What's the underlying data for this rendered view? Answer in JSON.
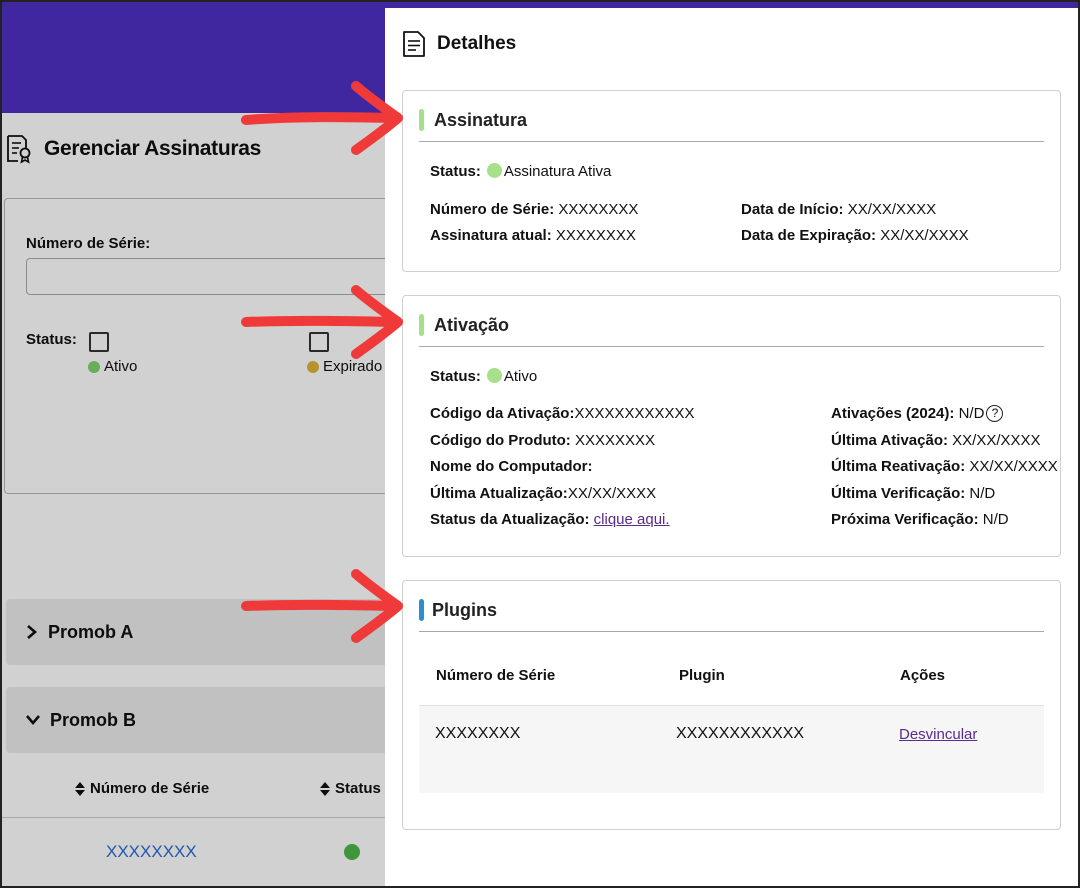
{
  "background": {
    "page_title": "Gerenciar Assinaturas",
    "filter": {
      "serial_label": "Número de Série:",
      "status_label": "Status:",
      "options": [
        {
          "label": "Ativo",
          "color": "#7fd46e"
        },
        {
          "label": "Expirado",
          "color": "#e0b43a"
        }
      ]
    },
    "accordions": [
      {
        "label": "Promob A",
        "expanded": false
      },
      {
        "label": "Promob B",
        "expanded": true
      }
    ],
    "table": {
      "columns": [
        "Número de Série",
        "Status"
      ],
      "rows": [
        {
          "serial": "XXXXXXXX",
          "status_color": "#4db847"
        }
      ]
    }
  },
  "drawer": {
    "title": "Detalhes",
    "assinatura": {
      "title": "Assinatura",
      "accent": "#a6e08a",
      "status_label": "Status:",
      "status_value": "Assinatura Ativa",
      "serial_label": "Número de Série:",
      "serial_value": "XXXXXXXX",
      "current_label": "Assinatura atual:",
      "current_value": "XXXXXXXX",
      "start_label": "Data de Início:",
      "start_value": "XX/XX/XXXX",
      "expiry_label": "Data de Expiração:",
      "expiry_value": "XX/XX/XXXX"
    },
    "ativacao": {
      "title": "Ativação",
      "accent": "#a6e08a",
      "status_label": "Status:",
      "status_value": "Ativo",
      "left": [
        {
          "label": "Código da Ativação:",
          "value": "XXXXXXXXXXXX"
        },
        {
          "label": "Código do Produto:",
          "value": "XXXXXXXX"
        },
        {
          "label": "Nome do Computador:",
          "value": ""
        },
        {
          "label": "Última Atualização:",
          "value": "XX/XX/XXXX"
        },
        {
          "label": "Status da Atualização:",
          "value": "clique aqui."
        }
      ],
      "right": [
        {
          "label": "Ativações (2024):",
          "value": "N/D",
          "help": "?"
        },
        {
          "label": "Última Ativação:",
          "value": "XX/XX/XXXX"
        },
        {
          "label": "Última Reativação:",
          "value": "XX/XX/XXXX"
        },
        {
          "label": "Última Verificação:",
          "value": "N/D"
        },
        {
          "label": "Próxima Verificação:",
          "value": "N/D"
        }
      ]
    },
    "plugins": {
      "title": "Plugins",
      "accent": "#2a8fd0",
      "columns": [
        "Número de Série",
        "Plugin",
        "Ações"
      ],
      "rows": [
        {
          "serial": "XXXXXXXX",
          "plugin": "XXXXXXXXXXXX",
          "action": "Desvincular"
        }
      ]
    }
  }
}
